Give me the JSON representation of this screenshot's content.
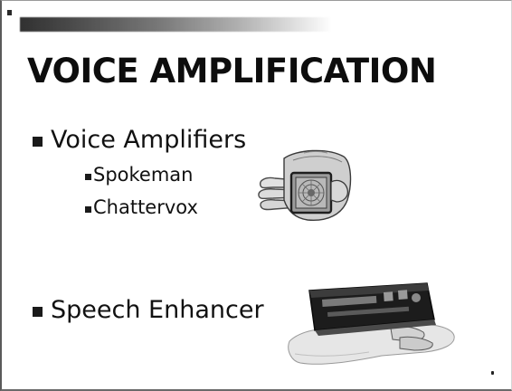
{
  "slide": {
    "title": "VOICE AMPLIFICATION",
    "bullets": [
      {
        "text": "Voice Amplifiers",
        "sub": [
          "Spokeman",
          "Chattervox"
        ]
      },
      {
        "text": "Speech Enhancer",
        "sub": []
      }
    ],
    "images": [
      "hand-held-voice-amplifier-photo",
      "speech-enhancer-device-in-hand-photo"
    ],
    "colors": {
      "text": "#111111",
      "background": "#ffffff",
      "bar_start": "#1b1b1b"
    }
  }
}
